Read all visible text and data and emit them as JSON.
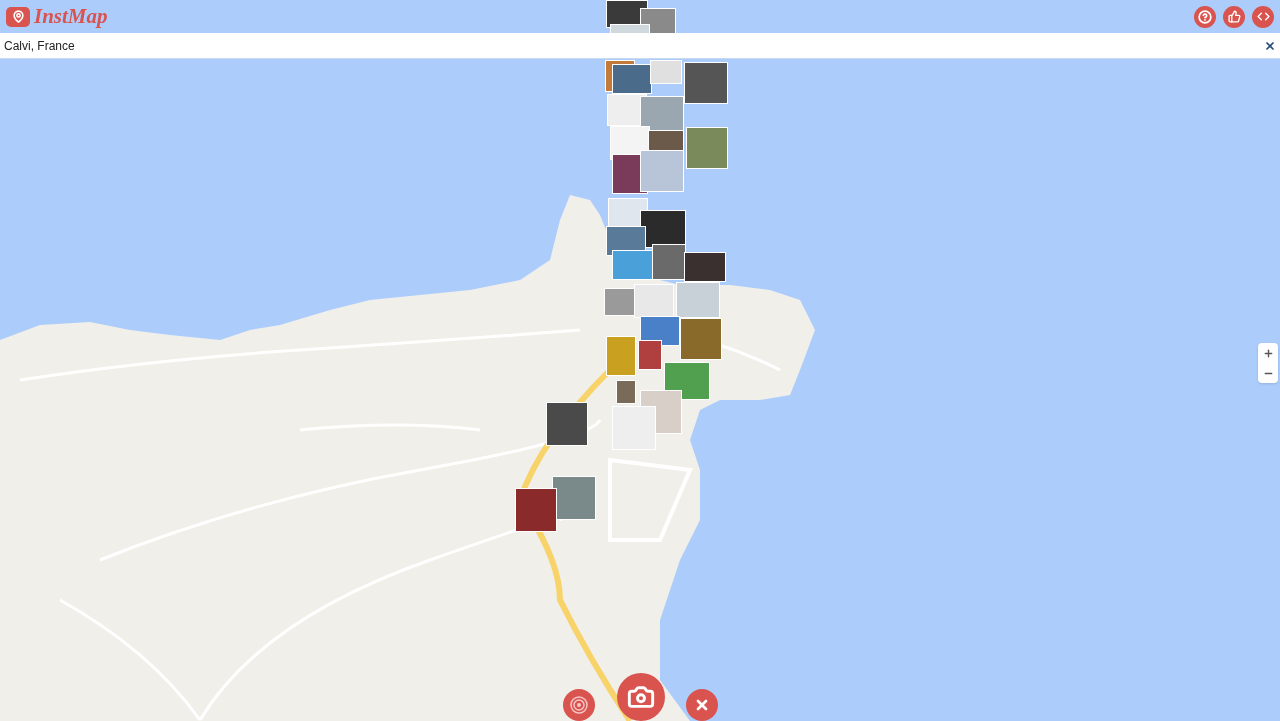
{
  "header": {
    "logo": "InstMap"
  },
  "search": {
    "value": "Calvi, France"
  }
}
